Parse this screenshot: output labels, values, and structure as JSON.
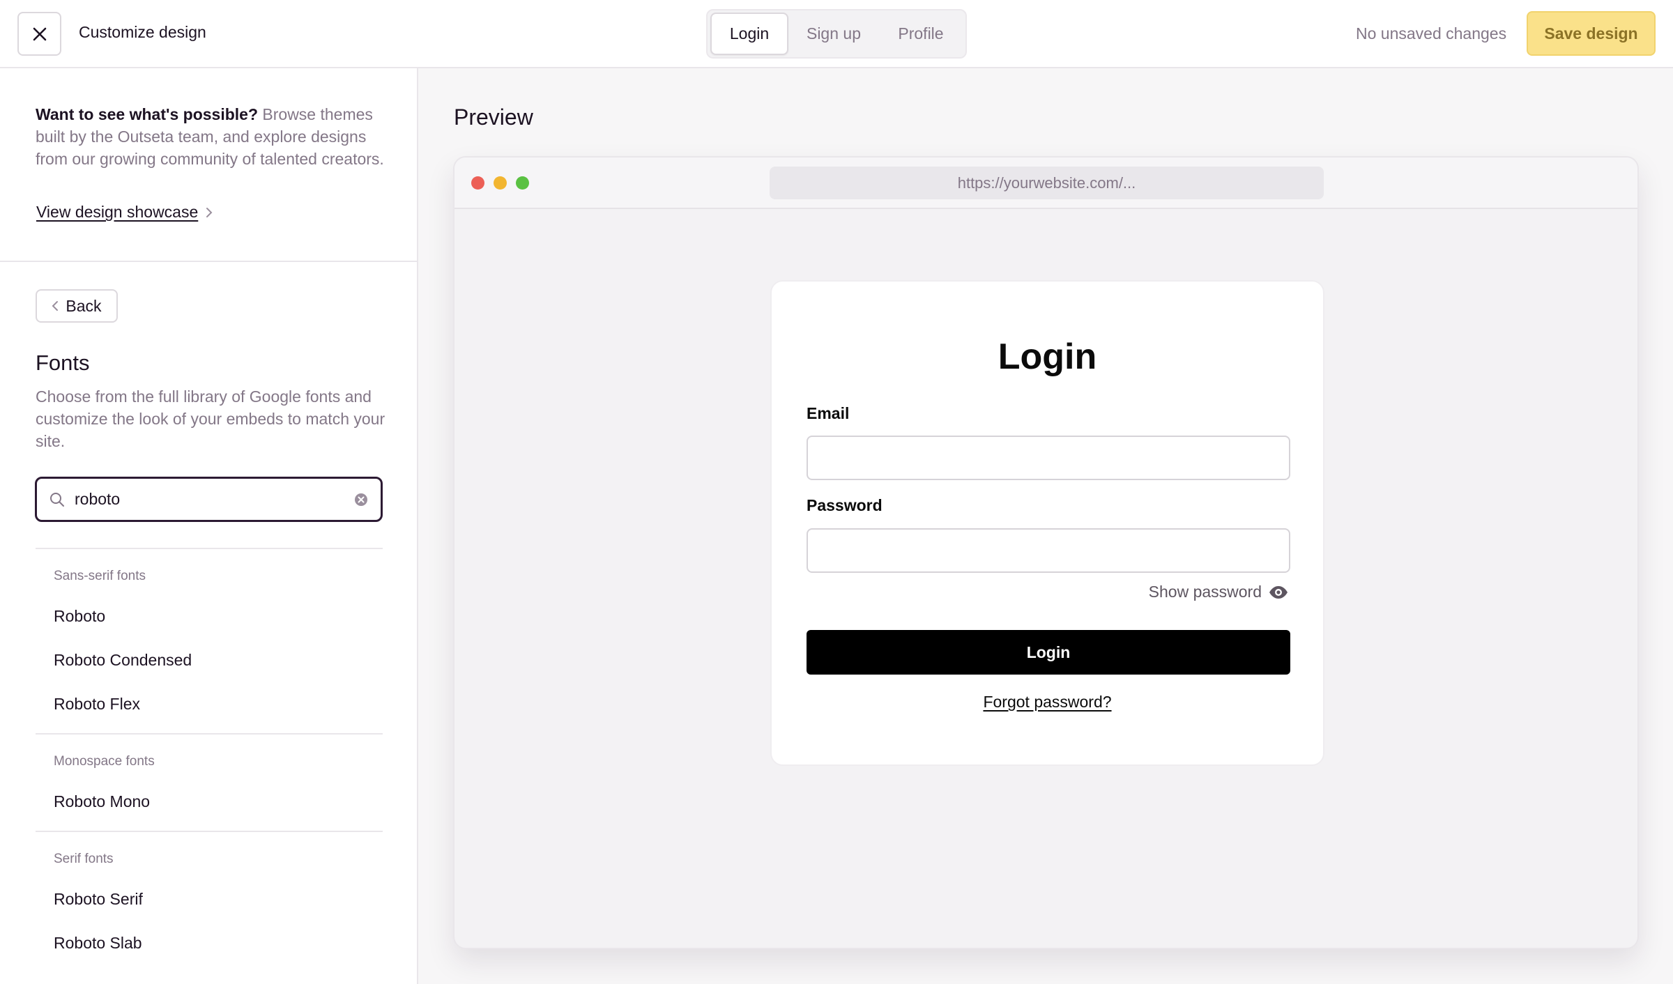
{
  "header": {
    "title": "Customize design",
    "tabs": [
      {
        "label": "Login",
        "active": true
      },
      {
        "label": "Sign up",
        "active": false
      },
      {
        "label": "Profile",
        "active": false
      }
    ],
    "status": "No unsaved changes",
    "save_label": "Save design"
  },
  "sidebar": {
    "promo_strong": "Want to see what's possible?",
    "promo_text": " Browse themes built by the Outseta team, and explore designs from our growing community of talented creators.",
    "showcase_link": "View design showcase",
    "back_label": "Back",
    "fonts_title": "Fonts",
    "fonts_description": "Choose from the full library of Google fonts and customize the look of your embeds to match your site.",
    "search_value": "roboto",
    "groups": [
      {
        "label": "Sans-serif fonts",
        "items": [
          "Roboto",
          "Roboto Condensed",
          "Roboto Flex"
        ]
      },
      {
        "label": "Monospace fonts",
        "items": [
          "Roboto Mono"
        ]
      },
      {
        "label": "Serif fonts",
        "items": [
          "Roboto Serif",
          "Roboto Slab"
        ]
      }
    ]
  },
  "preview": {
    "title": "Preview",
    "url": "https://yourwebsite.com/...",
    "card": {
      "title": "Login",
      "email_label": "Email",
      "password_label": "Password",
      "show_password": "Show password",
      "button": "Login",
      "forgot": "Forgot password?"
    }
  },
  "colors": {
    "accent_save": "#fae18a",
    "dot_red": "#ec5f56",
    "dot_yellow": "#f2b530",
    "dot_green": "#5ac142"
  }
}
